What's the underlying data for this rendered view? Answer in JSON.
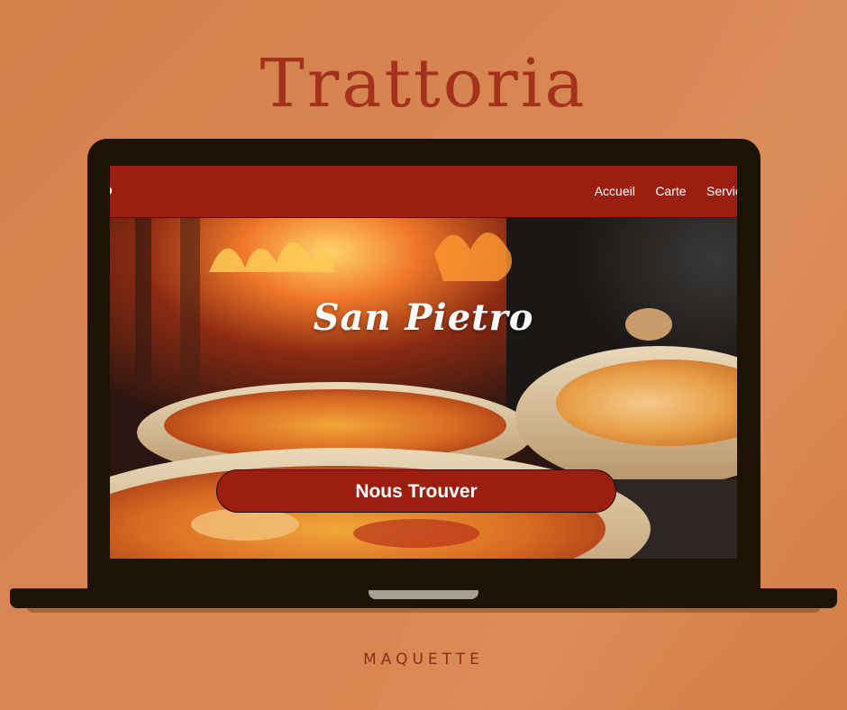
{
  "heading": "Trattoria",
  "caption": "MAQUETTE",
  "site": {
    "logo_fragment": "o",
    "nav": [
      {
        "label": "Accueil"
      },
      {
        "label": "Carte"
      },
      {
        "label": "Servic"
      }
    ],
    "hero_title": "San Pietro",
    "cta_label": "Nous Trouver"
  },
  "colors": {
    "background": "#d88753",
    "heading": "#a3311b",
    "header_red": "#9c1e10",
    "laptop": "#1d1305"
  },
  "icons": [
    "laptop-device-frame"
  ]
}
